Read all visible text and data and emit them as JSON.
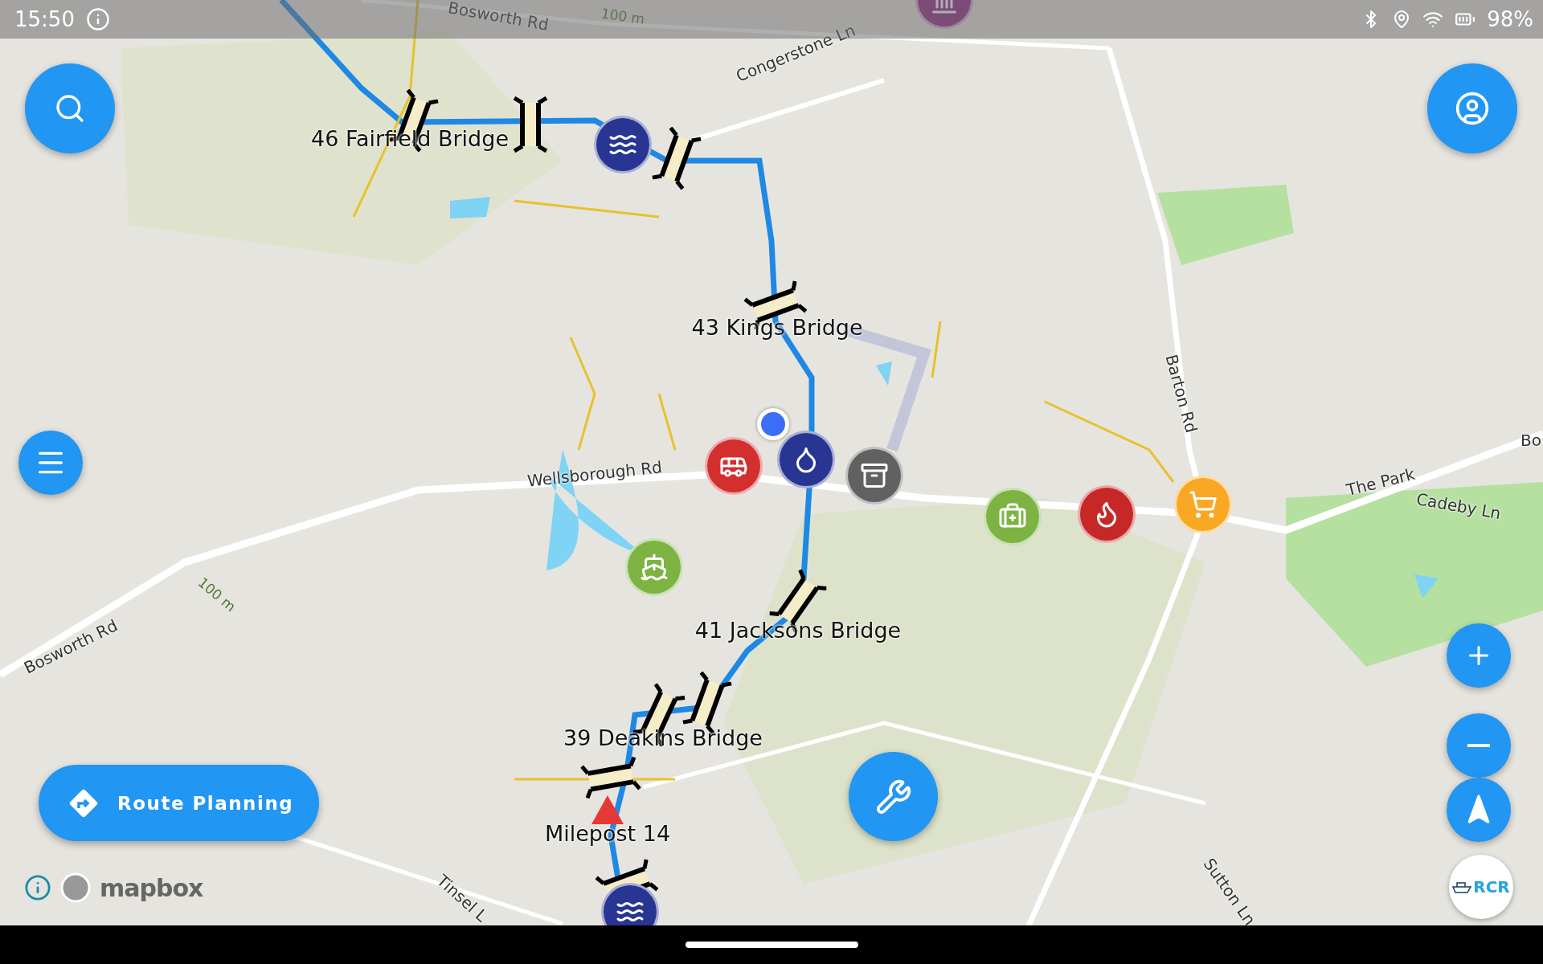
{
  "status_bar": {
    "time": "15:50",
    "battery": "98%"
  },
  "map": {
    "labels": [
      {
        "text": "Bosworth Rd",
        "kind": "road"
      },
      {
        "text": "100 m",
        "kind": "contour"
      },
      {
        "text": "Congerstone Ln",
        "kind": "road"
      },
      {
        "text": "46 Fairfield Bridge",
        "kind": "waypoint"
      },
      {
        "text": "43 Kings Bridge",
        "kind": "waypoint"
      },
      {
        "text": "Barton Rd",
        "kind": "road"
      },
      {
        "text": "Wellsborough Rd",
        "kind": "road"
      },
      {
        "text": "The Park",
        "kind": "road"
      },
      {
        "text": "Cadeby Ln",
        "kind": "road"
      },
      {
        "text": "Bo",
        "kind": "road"
      },
      {
        "text": "41 Jacksons Bridge",
        "kind": "waypoint"
      },
      {
        "text": "39 Deakins Bridge",
        "kind": "waypoint"
      },
      {
        "text": "Milepost 14",
        "kind": "waypoint"
      },
      {
        "text": "Bosworth Rd",
        "kind": "road"
      },
      {
        "text": "100 m",
        "kind": "contour"
      },
      {
        "text": "Tinsel L",
        "kind": "road"
      },
      {
        "text": "Sutton Ln",
        "kind": "road"
      }
    ],
    "pois": [
      {
        "kind": "lock"
      },
      {
        "kind": "bus"
      },
      {
        "kind": "tap"
      },
      {
        "kind": "bin"
      },
      {
        "kind": "firstaid"
      },
      {
        "kind": "fire"
      },
      {
        "kind": "shop"
      },
      {
        "kind": "jetski"
      },
      {
        "kind": "lock"
      },
      {
        "kind": "venue"
      }
    ],
    "attribution": "mapbox"
  },
  "route_button": {
    "label": "Route Planning"
  },
  "logo": {
    "text": "RCR"
  }
}
